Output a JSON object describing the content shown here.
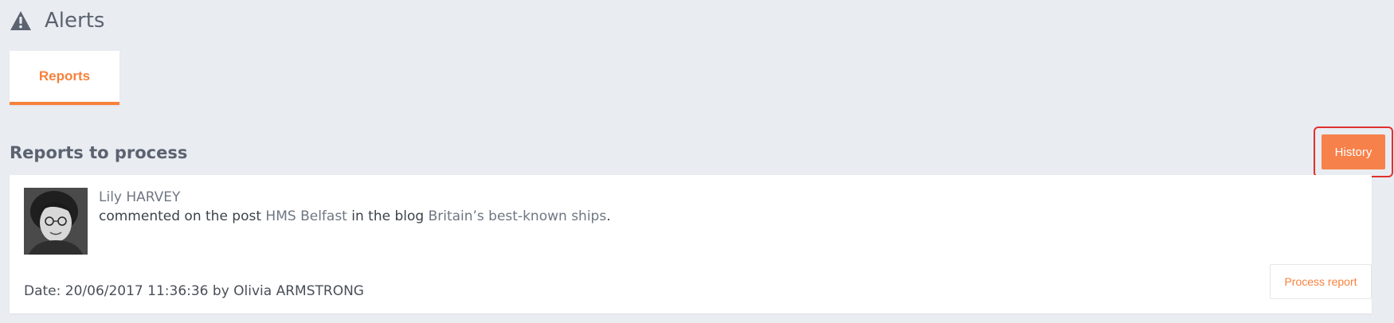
{
  "header": {
    "title": "Alerts",
    "icon": "warning-icon"
  },
  "tabs": [
    {
      "label": "Reports",
      "active": true
    }
  ],
  "section": {
    "title": "Reports to process",
    "history_label": "History"
  },
  "report": {
    "author": "Lily HARVEY",
    "text_before_post": "commented on the post ",
    "post_title": "HMS Belfast",
    "text_before_blog": " in the blog ",
    "blog_title": "Britain’s best-known ships",
    "text_end": ".",
    "meta": "Date: 20/06/2017 11:36:36 by Olivia ARMSTRONG",
    "process_label": "Process report"
  },
  "colors": {
    "accent": "#f6813c",
    "history_bg": "#f7814a",
    "highlight": "#e03030",
    "background": "#e9ecf1"
  }
}
